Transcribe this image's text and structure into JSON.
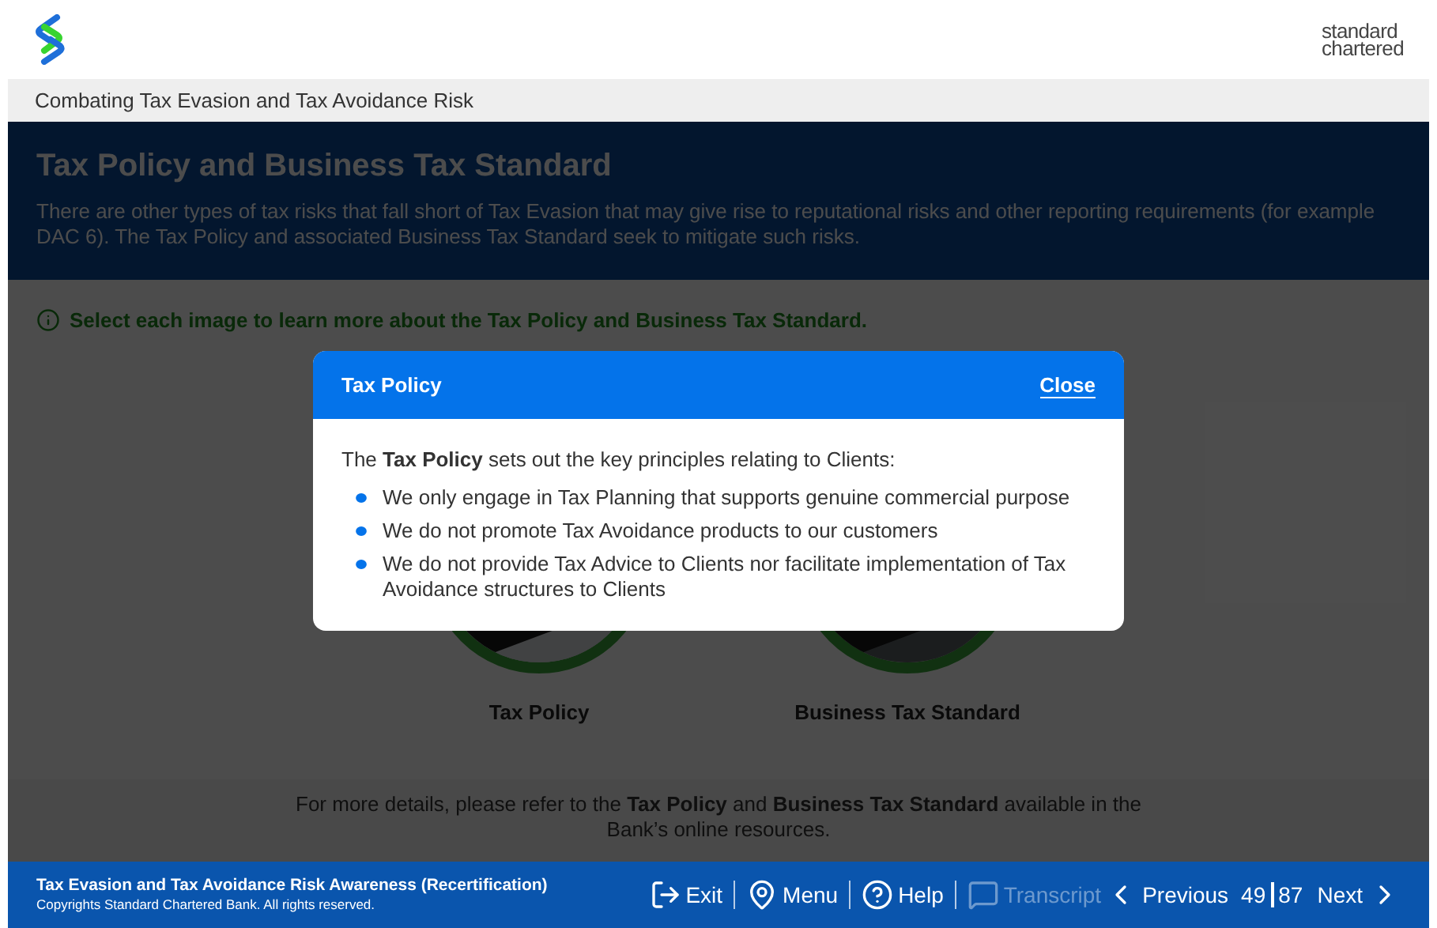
{
  "header": {
    "brand_lines": [
      "standard",
      "chartered"
    ]
  },
  "course_title": "Combating Tax Evasion and Tax Avoidance Risk",
  "banner": {
    "title": "Tax Policy and Business Tax Standard",
    "body": "There are other types of tax risks that fall short of Tax Evasion that may give rise to reputational risks and other reporting requirements (for example DAC 6). The Tax Policy and associated Business Tax Standard seek to mitigate such risks."
  },
  "instruction": "Select each image to learn more about the Tax Policy and Business Tax Standard.",
  "images": [
    {
      "label": "Tax Policy"
    },
    {
      "label": "Business Tax Standard"
    }
  ],
  "footer_note": "For more details, please refer to the **Tax Policy** and **Business Tax Standard** available in the Bank’s online resources.",
  "modal": {
    "title": "Tax Policy",
    "close": "Close",
    "intro": "The **Tax Policy** sets out the key principles relating to Clients:",
    "bullets": [
      "We only engage in Tax Planning that supports genuine commercial purpose",
      "We do not promote Tax Avoidance products to our customers",
      "We do not provide Tax Advice to Clients nor facilitate implementation of Tax Avoidance structures to Clients"
    ]
  },
  "bottom_bar": {
    "course": "Tax Evasion and Tax Avoidance Risk Awareness (Recertification)",
    "copyright": "Copyrights Standard Chartered Bank. All rights reserved.",
    "nav": [
      {
        "kind": "exit",
        "label": "Exit",
        "disabled": false
      },
      {
        "kind": "menu",
        "label": "Menu",
        "disabled": false
      },
      {
        "kind": "help",
        "label": "Help",
        "disabled": false
      },
      {
        "kind": "transcript",
        "label": "Transcript",
        "disabled": true
      }
    ],
    "previous": "Previous",
    "current_page": "49",
    "total_pages": "87",
    "next": "Next"
  }
}
